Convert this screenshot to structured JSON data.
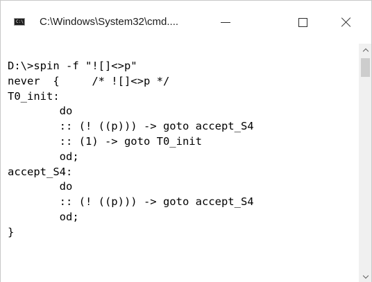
{
  "window": {
    "title": "C:\\Windows\\System32\\cmd....",
    "app_icon_text": "C:\\",
    "app_icon_name": "cmd-icon",
    "controls": {
      "minimize_icon": "minimize-icon",
      "maximize_icon": "maximize-icon",
      "close_icon": "close-icon"
    }
  },
  "console": {
    "lines": [
      "D:\\>spin -f \"![]<>p\"",
      "never  {     /* ![]<>p */",
      "T0_init:",
      "        do",
      "        :: (! ((p))) -> goto accept_S4",
      "        :: (1) -> goto T0_init",
      "        od;",
      "accept_S4:",
      "        do",
      "        :: (! ((p))) -> goto accept_S4",
      "        od;",
      "}"
    ]
  },
  "scrollbar": {
    "up_icon": "chevron-up-icon",
    "down_icon": "chevron-down-icon"
  },
  "colors": {
    "background": "#ffffff",
    "text": "#000000",
    "scrollbar_track": "#f0f0f0",
    "scrollbar_thumb": "#cdcdcd"
  }
}
